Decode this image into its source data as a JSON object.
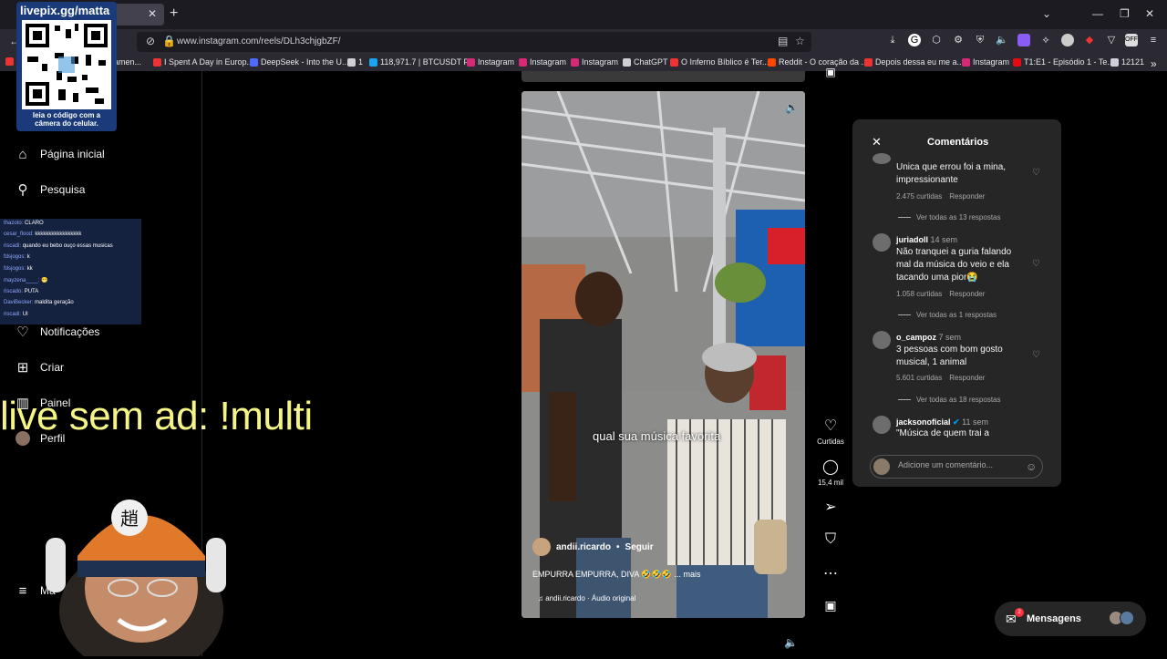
{
  "browser": {
    "url": "www.instagram.com/reels/DLh3chjgbZF/",
    "bookmarks": [
      {
        "label": "ramen...",
        "color": "#e33"
      },
      {
        "label": "I Spent A Day in Europ...",
        "color": "#e33"
      },
      {
        "label": "DeepSeek - Into the U...",
        "color": "#4d6bfe"
      },
      {
        "label": "1",
        "color": "#cfcfd8"
      },
      {
        "label": "118,971.7 | BTCUSDT P...",
        "color": "#1da1f2"
      },
      {
        "label": "Instagram",
        "color": "#d62976"
      },
      {
        "label": "Instagram",
        "color": "#d62976"
      },
      {
        "label": "Instagram",
        "color": "#d62976"
      },
      {
        "label": "ChatGPT",
        "color": "#cfcfd8"
      },
      {
        "label": "O Inferno Bíblico é Ter...",
        "color": "#e33"
      },
      {
        "label": "Reddit - O coração da ...",
        "color": "#ff4500"
      },
      {
        "label": "Depois dessa eu me a...",
        "color": "#e33"
      },
      {
        "label": "Instagram",
        "color": "#d62976"
      },
      {
        "label": "T1:E1 - Episódio 1 - Te...",
        "color": "#e50914"
      },
      {
        "label": "12121",
        "color": "#cfcfd8"
      }
    ]
  },
  "overlay": {
    "qr_title": "livepix.gg/matta",
    "qr_caption": "leia o código com a câmera do celular.",
    "live_ad": "live sem ad: !multi",
    "chat": [
      {
        "user": "thazoto:",
        "msg": "CLARO"
      },
      {
        "user": "cesar_flood:",
        "msg": "kkkkkkkkkkkkkkkkk"
      },
      {
        "user": "riscadi:",
        "msg": "quando eu bebo ouço essas musicas"
      },
      {
        "user": "fdsjogos:",
        "msg": "k"
      },
      {
        "user": "fdsjogos:",
        "msg": "kk"
      },
      {
        "user": "mayzena____:",
        "msg": "😬"
      },
      {
        "user": "riscado:",
        "msg": "PUTA"
      },
      {
        "user": "DaviBecker:",
        "msg": "maldita geração"
      },
      {
        "user": "riscadi:",
        "msg": "UI"
      }
    ]
  },
  "nav": {
    "home": "Página inicial",
    "search": "Pesquisa",
    "notifications": "Notificações",
    "create": "Criar",
    "dashboard": "Painel",
    "profile": "Perfil",
    "more": "Ma"
  },
  "reel": {
    "caption": "qual sua música favorita",
    "author": "andii.ricardo",
    "follow": "Seguir",
    "description": "EMPURRA EMPURRA, DIVA 🤣🤣🤣 ... mais",
    "audio": "♫ andii.ricardo · Áudio original",
    "likes_label": "Curtidas",
    "comments_count": "15,4 mil"
  },
  "comments": {
    "title": "Comentários",
    "items": [
      {
        "user": "",
        "time": "",
        "text": "Unica que errou foi a mina, impressionante",
        "likes": "2.475 curtidas",
        "reply": "Responder",
        "more": "Ver todas as 13 respostas"
      },
      {
        "user": "juriadoll",
        "time": "14 sem",
        "text": "Não tranquei a guria falando mal da música do veio e ela tacando uma pior😭",
        "likes": "1.058 curtidas",
        "reply": "Responder",
        "more": "Ver todas as 1 respostas"
      },
      {
        "user": "o_campoz",
        "time": "7 sem",
        "text": "3 pessoas com bom gosto musical, 1 animal",
        "likes": "5.601 curtidas",
        "reply": "Responder",
        "more": "Ver todas as 18 respostas"
      },
      {
        "user": "jacksonoficial",
        "time": "11 sem",
        "text": "\"Música de quem trai a",
        "likes": "",
        "reply": "",
        "more": ""
      }
    ],
    "input_placeholder": "Adicione um comentário..."
  },
  "messages": {
    "label": "Mensagens",
    "badge": "2"
  }
}
